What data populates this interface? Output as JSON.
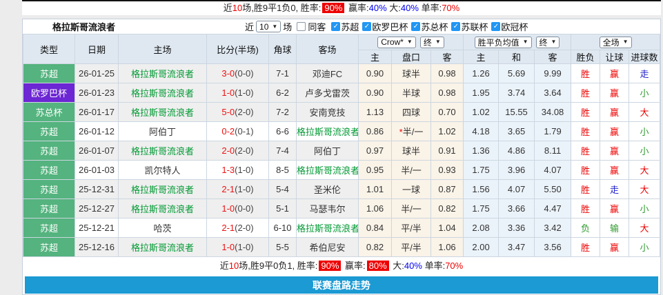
{
  "icons": {
    "checkmark": "✓",
    "dropdown_arrow": "▼"
  },
  "colors": {
    "type_green": "#54b37e",
    "type_purple": "#6c26d3",
    "team_link_green": "#009933",
    "highlight_red": "#ee0000",
    "stat_blue": "#0000ee",
    "footer_blue": "#1b9ad3",
    "checkbox_blue": "#2196f3",
    "header_bg": "#dfe8f1",
    "handicap_col_bg": "#faf3e8",
    "avg_col_bg": "#ebf3fa"
  },
  "top_summary": {
    "segments": [
      {
        "text": "近",
        "style": "plain"
      },
      {
        "text": "10",
        "style": "red"
      },
      {
        "text": "场,胜9平1负0, 胜率:",
        "style": "plain"
      },
      {
        "text": "90%",
        "style": "badge"
      },
      {
        "text": " 赢率:",
        "style": "plain"
      },
      {
        "text": "40%",
        "style": "blue"
      },
      {
        "text": " 大:",
        "style": "plain"
      },
      {
        "text": "40%",
        "style": "blue"
      },
      {
        "text": " 单率:",
        "style": "plain"
      },
      {
        "text": "70%",
        "style": "red"
      }
    ]
  },
  "panel": {
    "team_name": "格拉斯哥流浪者",
    "filter": {
      "near_label": "近",
      "count_value": "10",
      "games_label": "场",
      "same_venue_label": "同客",
      "leagues": [
        "苏超",
        "欧罗巴杯",
        "苏总杯",
        "苏联杯",
        "欧冠杯"
      ]
    }
  },
  "table": {
    "headers": {
      "left": [
        "类型",
        "日期",
        "主场",
        "比分(半场)",
        "角球",
        "客场"
      ],
      "group1": {
        "select1": "Crow*",
        "select2": "终",
        "cols": [
          "主",
          "盘口",
          "客"
        ]
      },
      "group2": {
        "select1": "胜平负均值",
        "select2": "终",
        "cols": [
          "主",
          "和",
          "客"
        ]
      },
      "group3": {
        "select1": "全场",
        "cols": [
          "胜负",
          "让球",
          "进球数"
        ]
      }
    },
    "rows": [
      {
        "type": "苏超",
        "type_color": "green",
        "date": "26-01-25",
        "home": "格拉斯哥流浪者",
        "home_is_team": true,
        "score": "3-0",
        "half": "(0-0)",
        "corner": "7-1",
        "away": "邓迪FC",
        "away_is_team": false,
        "odds_home": "0.90",
        "handicap": "球半",
        "handicap_star": false,
        "odds_away": "0.98",
        "avg_home": "1.26",
        "avg_draw": "5.69",
        "avg_away": "9.99",
        "result": "胜",
        "result_color": "red",
        "cover": "赢",
        "cover_color": "red",
        "goals": "走",
        "goals_color": "dblue",
        "shaded": true
      },
      {
        "type": "欧罗巴杯",
        "type_color": "purple",
        "date": "26-01-23",
        "home": "格拉斯哥流浪者",
        "home_is_team": true,
        "score": "1-0",
        "half": "(1-0)",
        "corner": "6-2",
        "away": "卢多戈雷茨",
        "away_is_team": false,
        "odds_home": "0.90",
        "handicap": "半球",
        "handicap_star": false,
        "odds_away": "0.98",
        "avg_home": "1.95",
        "avg_draw": "3.74",
        "avg_away": "3.64",
        "result": "胜",
        "result_color": "red",
        "cover": "赢",
        "cover_color": "red",
        "goals": "小",
        "goals_color": "green",
        "shaded": true
      },
      {
        "type": "苏总杯",
        "type_color": "green",
        "date": "26-01-17",
        "home": "格拉斯哥流浪者",
        "home_is_team": true,
        "score": "5-0",
        "half": "(2-0)",
        "corner": "7-2",
        "away": "安南竞技",
        "away_is_team": false,
        "odds_home": "1.13",
        "handicap": "四球",
        "handicap_star": false,
        "odds_away": "0.70",
        "avg_home": "1.02",
        "avg_draw": "15.55",
        "avg_away": "34.08",
        "result": "胜",
        "result_color": "red",
        "cover": "赢",
        "cover_color": "red",
        "goals": "大",
        "goals_color": "red",
        "shaded": true
      },
      {
        "type": "苏超",
        "type_color": "green",
        "date": "26-01-12",
        "home": "阿伯丁",
        "home_is_team": false,
        "score": "0-2",
        "half": "(0-1)",
        "corner": "6-6",
        "away": "格拉斯哥流浪者",
        "away_is_team": true,
        "odds_home": "0.86",
        "handicap": "半/一",
        "handicap_star": true,
        "odds_away": "1.02",
        "avg_home": "4.18",
        "avg_draw": "3.65",
        "avg_away": "1.79",
        "result": "胜",
        "result_color": "red",
        "cover": "赢",
        "cover_color": "red",
        "goals": "小",
        "goals_color": "green",
        "shaded": false
      },
      {
        "type": "苏超",
        "type_color": "green",
        "date": "26-01-07",
        "home": "格拉斯哥流浪者",
        "home_is_team": true,
        "score": "2-0",
        "half": "(2-0)",
        "corner": "7-4",
        "away": "阿伯丁",
        "away_is_team": false,
        "odds_home": "0.97",
        "handicap": "球半",
        "handicap_star": false,
        "odds_away": "0.91",
        "avg_home": "1.36",
        "avg_draw": "4.86",
        "avg_away": "8.11",
        "result": "胜",
        "result_color": "red",
        "cover": "赢",
        "cover_color": "red",
        "goals": "小",
        "goals_color": "green",
        "shaded": true
      },
      {
        "type": "苏超",
        "type_color": "green",
        "date": "26-01-03",
        "home": "凯尔特人",
        "home_is_team": false,
        "score": "1-3",
        "half": "(1-0)",
        "corner": "8-5",
        "away": "格拉斯哥流浪者",
        "away_is_team": true,
        "odds_home": "0.95",
        "handicap": "半/一",
        "handicap_star": false,
        "odds_away": "0.93",
        "avg_home": "1.75",
        "avg_draw": "3.96",
        "avg_away": "4.07",
        "result": "胜",
        "result_color": "red",
        "cover": "赢",
        "cover_color": "red",
        "goals": "大",
        "goals_color": "red",
        "shaded": false
      },
      {
        "type": "苏超",
        "type_color": "green",
        "date": "25-12-31",
        "home": "格拉斯哥流浪者",
        "home_is_team": true,
        "score": "2-1",
        "half": "(1-0)",
        "corner": "5-4",
        "away": "圣米伦",
        "away_is_team": false,
        "odds_home": "1.01",
        "handicap": "一球",
        "handicap_star": false,
        "odds_away": "0.87",
        "avg_home": "1.56",
        "avg_draw": "4.07",
        "avg_away": "5.50",
        "result": "胜",
        "result_color": "red",
        "cover": "走",
        "cover_color": "dblue",
        "goals": "大",
        "goals_color": "red",
        "shaded": true
      },
      {
        "type": "苏超",
        "type_color": "green",
        "date": "25-12-27",
        "home": "格拉斯哥流浪者",
        "home_is_team": true,
        "score": "1-0",
        "half": "(0-0)",
        "corner": "5-1",
        "away": "马瑟韦尔",
        "away_is_team": false,
        "odds_home": "1.06",
        "handicap": "半/一",
        "handicap_star": false,
        "odds_away": "0.82",
        "avg_home": "1.75",
        "avg_draw": "3.66",
        "avg_away": "4.47",
        "result": "胜",
        "result_color": "red",
        "cover": "赢",
        "cover_color": "red",
        "goals": "小",
        "goals_color": "green",
        "shaded": true
      },
      {
        "type": "苏超",
        "type_color": "green",
        "date": "25-12-21",
        "home": "哈茨",
        "home_is_team": false,
        "score": "2-1",
        "half": "(2-0)",
        "corner": "6-10",
        "away": "格拉斯哥流浪者",
        "away_is_team": true,
        "odds_home": "0.84",
        "handicap": "平/半",
        "handicap_star": false,
        "odds_away": "1.04",
        "avg_home": "2.08",
        "avg_draw": "3.36",
        "avg_away": "3.42",
        "result": "负",
        "result_color": "green",
        "cover": "输",
        "cover_color": "green",
        "goals": "大",
        "goals_color": "red",
        "shaded": false
      },
      {
        "type": "苏超",
        "type_color": "green",
        "date": "25-12-16",
        "home": "格拉斯哥流浪者",
        "home_is_team": true,
        "score": "1-0",
        "half": "(1-0)",
        "corner": "5-5",
        "away": "希伯尼安",
        "away_is_team": false,
        "odds_home": "0.82",
        "handicap": "平/半",
        "handicap_star": false,
        "odds_away": "1.06",
        "avg_home": "2.00",
        "avg_draw": "3.47",
        "avg_away": "3.56",
        "result": "胜",
        "result_color": "red",
        "cover": "赢",
        "cover_color": "red",
        "goals": "小",
        "goals_color": "green",
        "shaded": true
      }
    ]
  },
  "bottom_summary": {
    "segments": [
      {
        "text": "近",
        "style": "plain"
      },
      {
        "text": "10",
        "style": "red"
      },
      {
        "text": "场,胜9平0负1, 胜率:",
        "style": "plain"
      },
      {
        "text": "90%",
        "style": "badge"
      },
      {
        "text": " 赢率:",
        "style": "plain"
      },
      {
        "text": "80%",
        "style": "badge"
      },
      {
        "text": " 大:",
        "style": "plain"
      },
      {
        "text": "40%",
        "style": "blue"
      },
      {
        "text": " 单率:",
        "style": "plain"
      },
      {
        "text": "70%",
        "style": "red"
      }
    ]
  },
  "footer": {
    "label": "联赛盘路走势"
  }
}
